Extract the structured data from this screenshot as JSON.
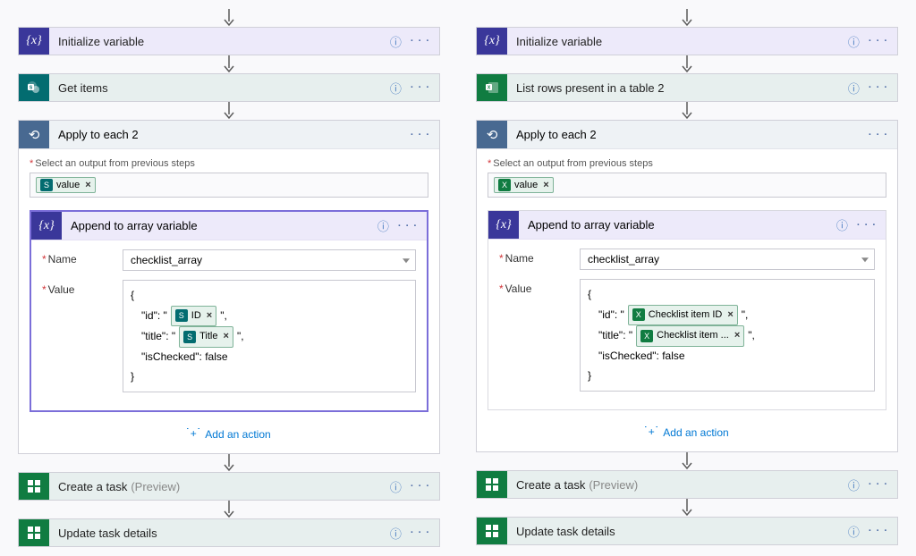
{
  "left": {
    "init_var": "Initialize variable",
    "get_items": "Get items",
    "apply": {
      "title": "Apply to each 2",
      "hint": "Select an output from previous steps",
      "token": "value",
      "append": {
        "title": "Append to array variable",
        "name_label": "Name",
        "name_value": "checklist_array",
        "value_label": "Value",
        "json_open": "{",
        "id_key": "\"id\": \"",
        "id_token": "ID",
        "q_comma": "\",",
        "title_key": "\"title\": \"",
        "title_token": "Title",
        "isChecked": "\"isChecked\": false",
        "json_close": "}"
      },
      "add_action": "Add an action"
    },
    "create_task": "Create a task",
    "preview": "(Preview)",
    "update_task": "Update task details"
  },
  "right": {
    "init_var": "Initialize variable",
    "list_rows": "List rows present in a table 2",
    "apply": {
      "title": "Apply to each 2",
      "hint": "Select an output from previous steps",
      "token": "value",
      "append": {
        "title": "Append to array variable",
        "name_label": "Name",
        "name_value": "checklist_array",
        "value_label": "Value",
        "json_open": "{",
        "id_key": "\"id\": \"",
        "id_token": "Checklist item ID",
        "q_comma": "\",",
        "title_key": "\"title\": \"",
        "title_token": "Checklist item ...",
        "isChecked": "\"isChecked\": false",
        "json_close": "}"
      },
      "add_action": "Add an action"
    },
    "create_task": "Create a task",
    "preview": "(Preview)",
    "update_task": "Update task details"
  }
}
